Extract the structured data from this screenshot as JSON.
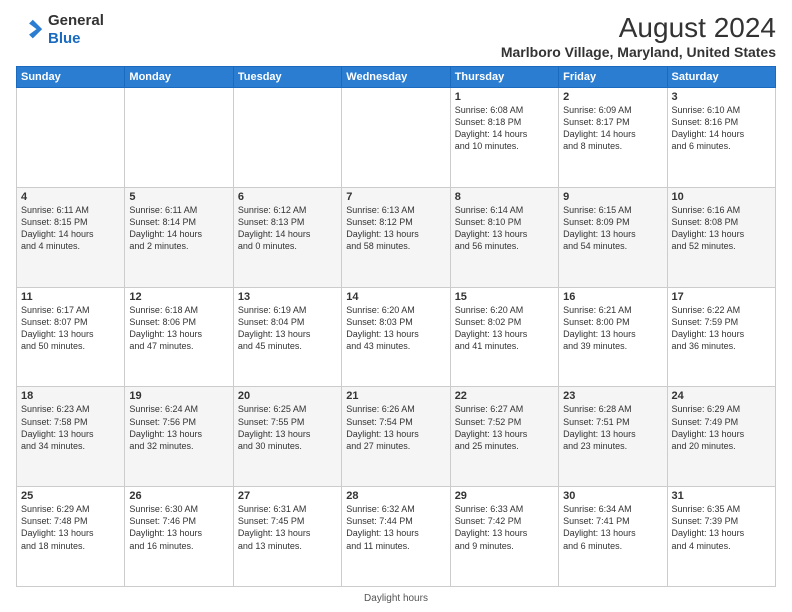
{
  "header": {
    "logo_line1": "General",
    "logo_line2": "Blue",
    "main_title": "August 2024",
    "subtitle": "Marlboro Village, Maryland, United States"
  },
  "days_of_week": [
    "Sunday",
    "Monday",
    "Tuesday",
    "Wednesday",
    "Thursday",
    "Friday",
    "Saturday"
  ],
  "weeks": [
    [
      {
        "num": "",
        "info": ""
      },
      {
        "num": "",
        "info": ""
      },
      {
        "num": "",
        "info": ""
      },
      {
        "num": "",
        "info": ""
      },
      {
        "num": "1",
        "info": "Sunrise: 6:08 AM\nSunset: 8:18 PM\nDaylight: 14 hours\nand 10 minutes."
      },
      {
        "num": "2",
        "info": "Sunrise: 6:09 AM\nSunset: 8:17 PM\nDaylight: 14 hours\nand 8 minutes."
      },
      {
        "num": "3",
        "info": "Sunrise: 6:10 AM\nSunset: 8:16 PM\nDaylight: 14 hours\nand 6 minutes."
      }
    ],
    [
      {
        "num": "4",
        "info": "Sunrise: 6:11 AM\nSunset: 8:15 PM\nDaylight: 14 hours\nand 4 minutes."
      },
      {
        "num": "5",
        "info": "Sunrise: 6:11 AM\nSunset: 8:14 PM\nDaylight: 14 hours\nand 2 minutes."
      },
      {
        "num": "6",
        "info": "Sunrise: 6:12 AM\nSunset: 8:13 PM\nDaylight: 14 hours\nand 0 minutes."
      },
      {
        "num": "7",
        "info": "Sunrise: 6:13 AM\nSunset: 8:12 PM\nDaylight: 13 hours\nand 58 minutes."
      },
      {
        "num": "8",
        "info": "Sunrise: 6:14 AM\nSunset: 8:10 PM\nDaylight: 13 hours\nand 56 minutes."
      },
      {
        "num": "9",
        "info": "Sunrise: 6:15 AM\nSunset: 8:09 PM\nDaylight: 13 hours\nand 54 minutes."
      },
      {
        "num": "10",
        "info": "Sunrise: 6:16 AM\nSunset: 8:08 PM\nDaylight: 13 hours\nand 52 minutes."
      }
    ],
    [
      {
        "num": "11",
        "info": "Sunrise: 6:17 AM\nSunset: 8:07 PM\nDaylight: 13 hours\nand 50 minutes."
      },
      {
        "num": "12",
        "info": "Sunrise: 6:18 AM\nSunset: 8:06 PM\nDaylight: 13 hours\nand 47 minutes."
      },
      {
        "num": "13",
        "info": "Sunrise: 6:19 AM\nSunset: 8:04 PM\nDaylight: 13 hours\nand 45 minutes."
      },
      {
        "num": "14",
        "info": "Sunrise: 6:20 AM\nSunset: 8:03 PM\nDaylight: 13 hours\nand 43 minutes."
      },
      {
        "num": "15",
        "info": "Sunrise: 6:20 AM\nSunset: 8:02 PM\nDaylight: 13 hours\nand 41 minutes."
      },
      {
        "num": "16",
        "info": "Sunrise: 6:21 AM\nSunset: 8:00 PM\nDaylight: 13 hours\nand 39 minutes."
      },
      {
        "num": "17",
        "info": "Sunrise: 6:22 AM\nSunset: 7:59 PM\nDaylight: 13 hours\nand 36 minutes."
      }
    ],
    [
      {
        "num": "18",
        "info": "Sunrise: 6:23 AM\nSunset: 7:58 PM\nDaylight: 13 hours\nand 34 minutes."
      },
      {
        "num": "19",
        "info": "Sunrise: 6:24 AM\nSunset: 7:56 PM\nDaylight: 13 hours\nand 32 minutes."
      },
      {
        "num": "20",
        "info": "Sunrise: 6:25 AM\nSunset: 7:55 PM\nDaylight: 13 hours\nand 30 minutes."
      },
      {
        "num": "21",
        "info": "Sunrise: 6:26 AM\nSunset: 7:54 PM\nDaylight: 13 hours\nand 27 minutes."
      },
      {
        "num": "22",
        "info": "Sunrise: 6:27 AM\nSunset: 7:52 PM\nDaylight: 13 hours\nand 25 minutes."
      },
      {
        "num": "23",
        "info": "Sunrise: 6:28 AM\nSunset: 7:51 PM\nDaylight: 13 hours\nand 23 minutes."
      },
      {
        "num": "24",
        "info": "Sunrise: 6:29 AM\nSunset: 7:49 PM\nDaylight: 13 hours\nand 20 minutes."
      }
    ],
    [
      {
        "num": "25",
        "info": "Sunrise: 6:29 AM\nSunset: 7:48 PM\nDaylight: 13 hours\nand 18 minutes."
      },
      {
        "num": "26",
        "info": "Sunrise: 6:30 AM\nSunset: 7:46 PM\nDaylight: 13 hours\nand 16 minutes."
      },
      {
        "num": "27",
        "info": "Sunrise: 6:31 AM\nSunset: 7:45 PM\nDaylight: 13 hours\nand 13 minutes."
      },
      {
        "num": "28",
        "info": "Sunrise: 6:32 AM\nSunset: 7:44 PM\nDaylight: 13 hours\nand 11 minutes."
      },
      {
        "num": "29",
        "info": "Sunrise: 6:33 AM\nSunset: 7:42 PM\nDaylight: 13 hours\nand 9 minutes."
      },
      {
        "num": "30",
        "info": "Sunrise: 6:34 AM\nSunset: 7:41 PM\nDaylight: 13 hours\nand 6 minutes."
      },
      {
        "num": "31",
        "info": "Sunrise: 6:35 AM\nSunset: 7:39 PM\nDaylight: 13 hours\nand 4 minutes."
      }
    ]
  ],
  "footer": {
    "daylight_label": "Daylight hours"
  },
  "colors": {
    "header_bg": "#2a7dd1",
    "accent": "#1a6bbf"
  }
}
